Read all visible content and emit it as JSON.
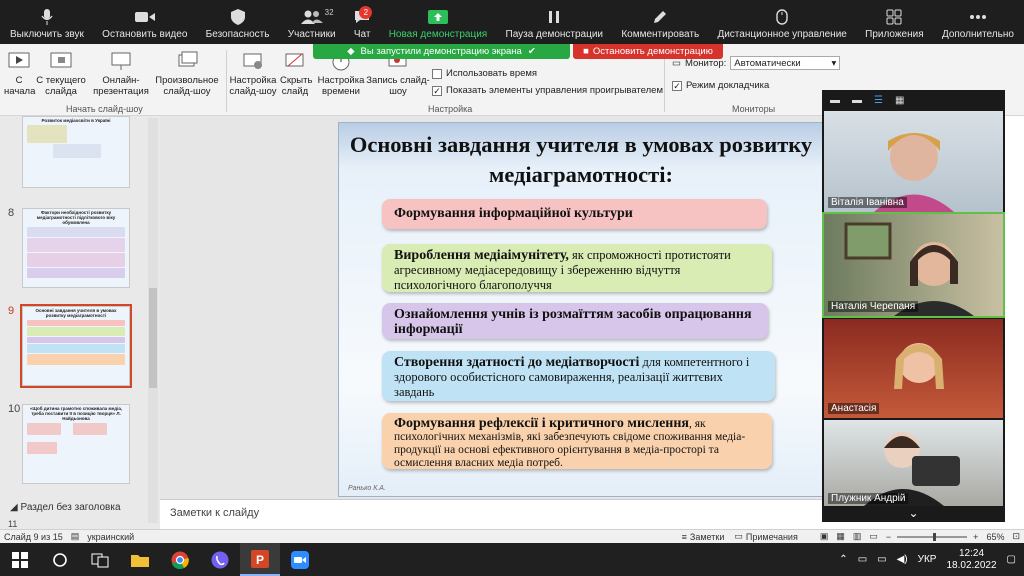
{
  "zoom_toolbar": {
    "mute": "Выключить звук",
    "stop_video": "Остановить видео",
    "security": "Безопасность",
    "participants": "Участники",
    "participants_count": "32",
    "chat": "Чат",
    "chat_badge": "2",
    "new_share": "Новая демонстрация",
    "pause_share": "Пауза демонстрации",
    "annotate": "Комментировать",
    "remote_control": "Дистанционное управление",
    "apps": "Приложения",
    "more": "Дополнительно"
  },
  "share_banner": {
    "started": "Вы запустили демонстрацию экрана",
    "stop": "Остановить демонстрацию"
  },
  "ribbon": {
    "from_start": "С начала",
    "from_current": "С текущего слайда",
    "online": "Онлайн-презентация",
    "custom": "Произвольное слайд-шоу",
    "setup": "Настройка слайд-шоу",
    "hide": "Скрыть слайд",
    "timing": "Настройка времени",
    "record": "Запись слайд-шоу",
    "group_start": "Начать слайд-шоу",
    "group_settings": "Настройка",
    "group_monitors": "Мониторы",
    "use_timings": "Использовать время",
    "show_controls": "Показать элементы управления проигрывателем",
    "monitor_label": "Монитор:",
    "monitor_value": "Автоматически",
    "presenter_view": "Режим докладчика"
  },
  "thumbnails": {
    "items": [
      {
        "num": "",
        "title": "Розвиток медіаосвіти в Україні"
      },
      {
        "num": "8",
        "title": "Фактори необхідності розвитку медіаграмотності підліткового віку обумовлена"
      },
      {
        "num": "9",
        "title": "Основні завдання учителя в умовах розвитку медіаграмотності"
      },
      {
        "num": "10",
        "title": "«Щоб дитина грамотно споживала медіа, треба поставити її в позицію творця» Л. Найдьонова"
      }
    ],
    "section": "Раздел без заголовка",
    "next_num": "11"
  },
  "slide": {
    "title": "Основні завдання учителя в умовах розвитку медіаграмотності:",
    "items": [
      {
        "bold": "Формування інформаційної культури",
        "rest": ""
      },
      {
        "bold": "Вироблення медіаімунітету,",
        "rest": " як спроможності протистояти агресивному медіасередовищу і збереженню відчуття психологічного благополуччя"
      },
      {
        "bold": "Ознайомлення учнів із розмаїттям засобів опрацювання інформації",
        "rest": ""
      },
      {
        "bold": "Створення здатності до медіатворчості",
        "rest": " для компетентного і здорового особистісного самовираження, реалізації життєвих завдань"
      },
      {
        "bold": "Формування рефлексії і критичного мислення",
        "rest": ", як психологічних механізмів, які забезпечують свідоме споживання медіа-продукції на основі ефективного орієнтування в медіа-просторі та осмислення власних медіа потреб."
      }
    ],
    "footer": "Ранько К.А."
  },
  "notes_placeholder": "Заметки к слайду",
  "status": {
    "slide_of": "Слайд 9 из 15",
    "language": "украинский",
    "notes": "Заметки",
    "comments": "Примечания",
    "zoom": "65%"
  },
  "video_panel": {
    "participants": [
      "Віталія Іванівна",
      "Наталія Черепаня",
      "Анастасія",
      "Плужник Андрій"
    ]
  },
  "taskbar": {
    "language": "УКР",
    "time": "12:24",
    "date": "18.02.2022"
  },
  "colors": {
    "item1": "#f6c2c2",
    "item2": "#d9ecb3",
    "item3": "#d7c6ea",
    "item4": "#bfe3f4",
    "item5": "#f9d2ad",
    "accent": "#d24726"
  }
}
